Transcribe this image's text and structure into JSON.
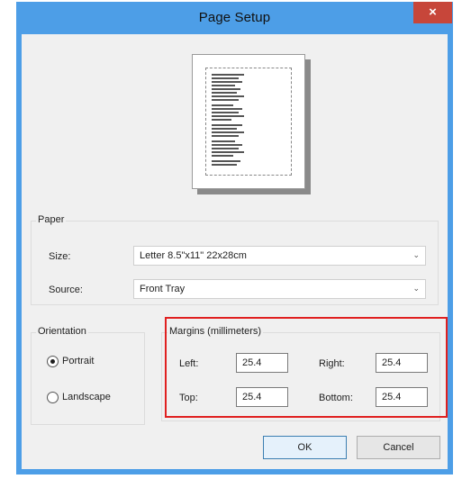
{
  "window": {
    "title": "Page Setup",
    "close_glyph": "×"
  },
  "icons": {
    "close": "close-icon",
    "combo_arrow": "chevron-down-icon"
  },
  "colors": {
    "titlebar": "#4d9ee7",
    "close_button": "#c7463a",
    "highlight_box": "#e02020"
  },
  "paper": {
    "group_label": "Paper",
    "size_label": "Size:",
    "size_value": "Letter 8.5\"x11\" 22x28cm",
    "source_label": "Source:",
    "source_value": "Front Tray",
    "arrow": "⌄"
  },
  "orientation": {
    "group_label": "Orientation",
    "portrait_label": "Portrait",
    "landscape_label": "Landscape",
    "selected": "Portrait"
  },
  "margins": {
    "group_label": "Margins (millimeters)",
    "left_label": "Left:",
    "left_value": "25.4",
    "right_label": "Right:",
    "right_value": "25.4",
    "top_label": "Top:",
    "top_value": "25.4",
    "bottom_label": "Bottom:",
    "bottom_value": "25.4"
  },
  "buttons": {
    "ok": "OK",
    "cancel": "Cancel"
  }
}
